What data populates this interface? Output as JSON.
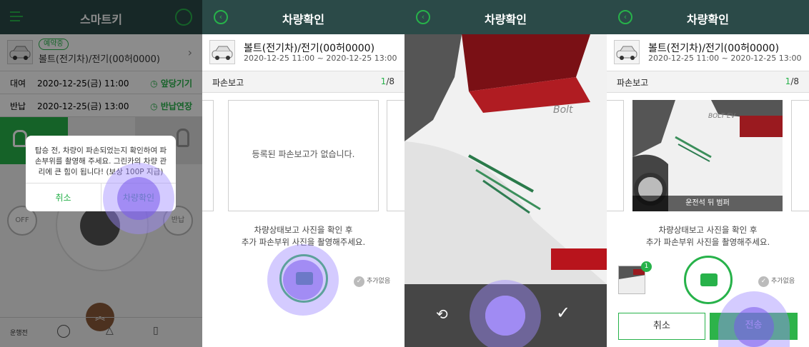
{
  "panel1": {
    "title": "스마트키",
    "badge": "예약중",
    "car": "볼트(전기차)/전기(00허0000)",
    "rent_label": "대여",
    "rent_date": "2020-12-25(금) 11:00",
    "rent_action": "앞당기기",
    "return_label": "반납",
    "return_date": "2020-12-25(금) 13:00",
    "return_action": "반납연장",
    "dialog_message": "탑승 전, 차량이 파손되었는지 확인하여 파손부위를 촬영해 주세요. 그린카의 차량 관리에 큰 힘이 됩니다! (보상 100P 지급)",
    "cancel": "취소",
    "confirm": "차량확인",
    "off": "OFF",
    "return_btn": "반납",
    "bottom_label": "운행전"
  },
  "common": {
    "title": "차량확인",
    "car": "볼트(전기차)/전기(00허0000)",
    "date": "2020-12-25 11:00 ~ 2020-12-25 13:00",
    "section": "파손보고",
    "count_current": "1",
    "count_total": "/8",
    "hint1": "차량상태보고 사진을 확인 후",
    "hint2": "추가 파손부위 사진을 촬영해주세요.",
    "no_add": "추가없음"
  },
  "panel2": {
    "empty": "등록된 파손보고가 없습니다."
  },
  "panel4": {
    "photo_caption": "운전석 뒤 범퍼",
    "thumb_badge": "1",
    "cancel": "취소",
    "send": "전송"
  },
  "colors": {
    "header": "#2b4a48",
    "accent": "#27b24a",
    "touch": "#a08cff"
  }
}
